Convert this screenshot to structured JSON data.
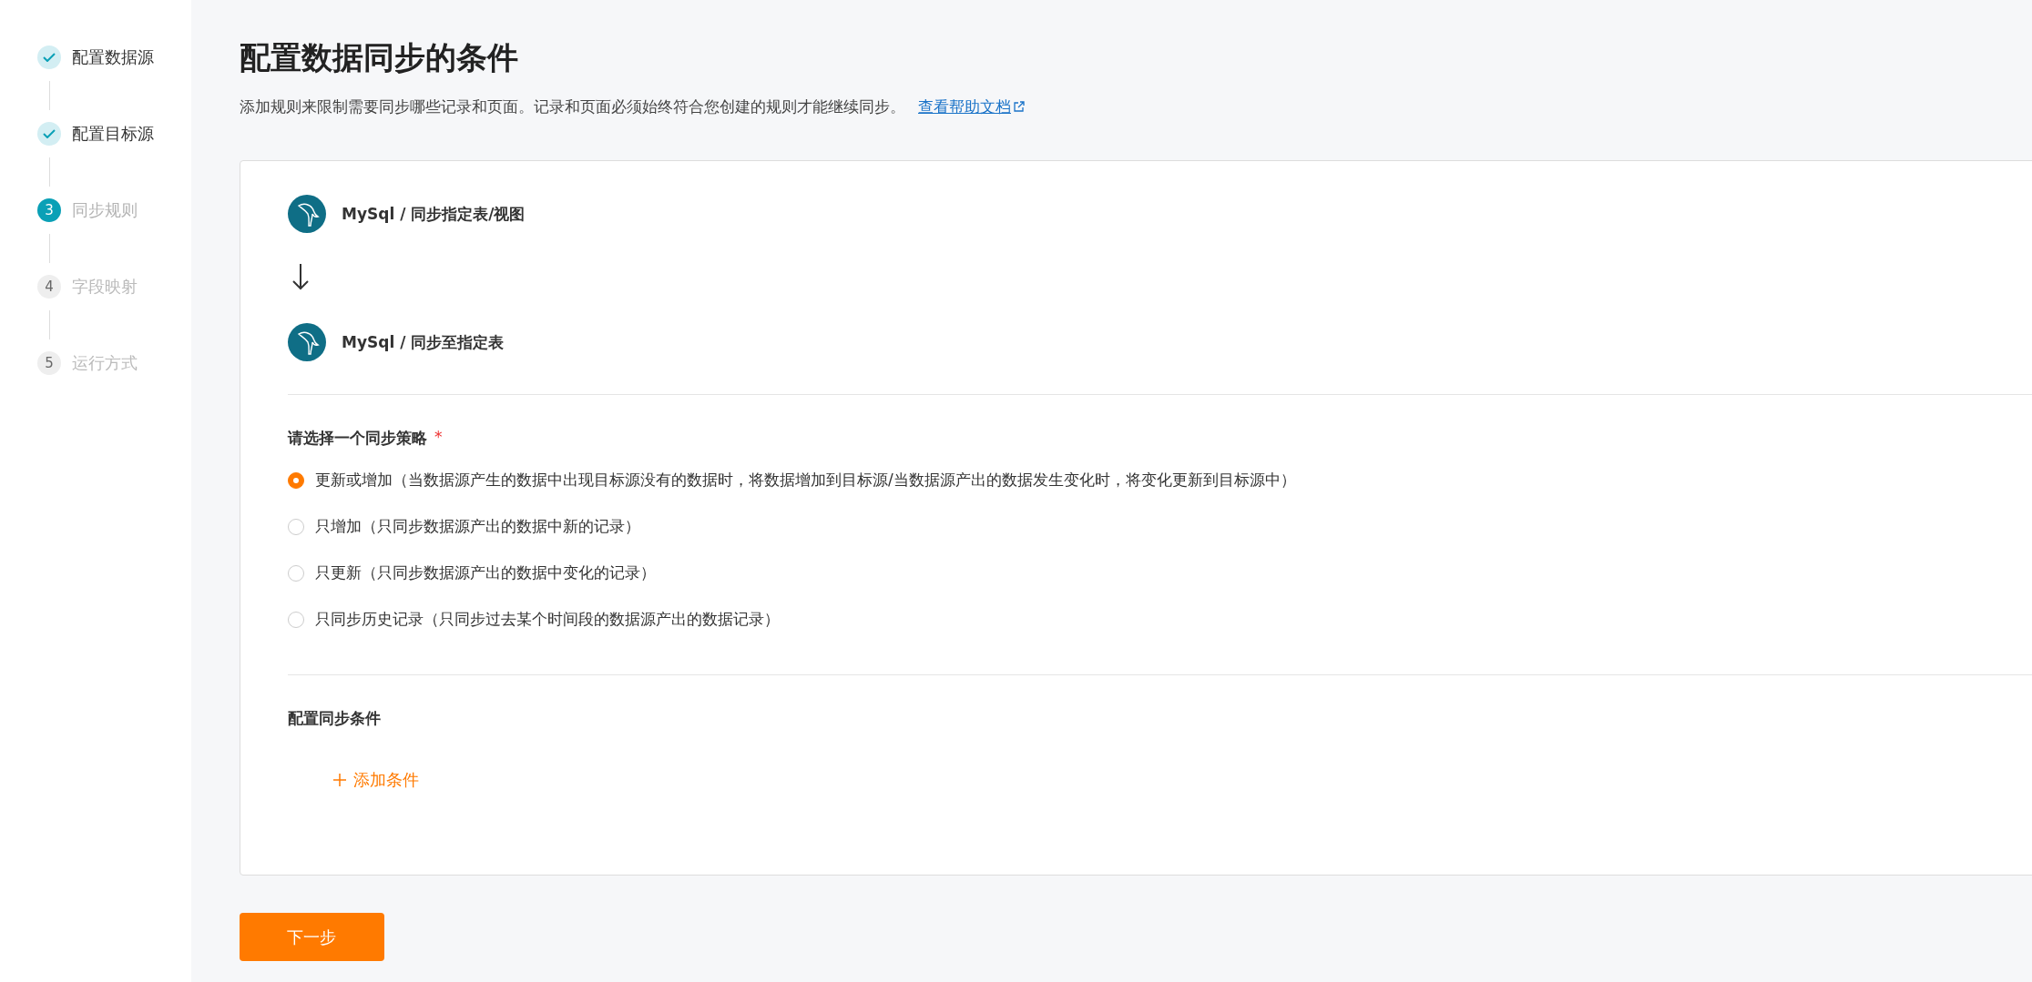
{
  "steps": [
    {
      "label": "配置数据源",
      "done": true,
      "selected": false
    },
    {
      "label": "配置目标源",
      "done": true,
      "selected": false
    },
    {
      "number": "3",
      "label": "同步规则",
      "done": false,
      "selected": true
    },
    {
      "number": "4",
      "label": "字段映射",
      "done": false,
      "selected": false
    },
    {
      "number": "5",
      "label": "运行方式",
      "done": false,
      "selected": false
    }
  ],
  "header": {
    "title": "配置数据同步的条件",
    "description": "添加规则来限制需要同步哪些记录和页面。记录和页面必须始终符合您创建的规则才能继续同步。",
    "help_link": "查看帮助文档"
  },
  "flow": {
    "source": "MySql / 同步指定表/视图",
    "target": "MySql / 同步至指定表"
  },
  "strategy": {
    "label": "请选择一个同步策略",
    "required_mark": "*",
    "options": [
      {
        "label": "更新或增加（当数据源产生的数据中出现目标源没有的数据时，将数据增加到目标源/当数据源产出的数据发生变化时，将变化更新到目标源中）",
        "selected": true
      },
      {
        "label": "只增加（只同步数据源产出的数据中新的记录）",
        "selected": false
      },
      {
        "label": "只更新（只同步数据源产出的数据中变化的记录）",
        "selected": false
      },
      {
        "label": "只同步历史记录（只同步过去某个时间段的数据源产出的数据记录）",
        "selected": false
      }
    ]
  },
  "conditions": {
    "title": "配置同步条件",
    "add_button": "添加条件"
  },
  "next_button": "下一步"
}
